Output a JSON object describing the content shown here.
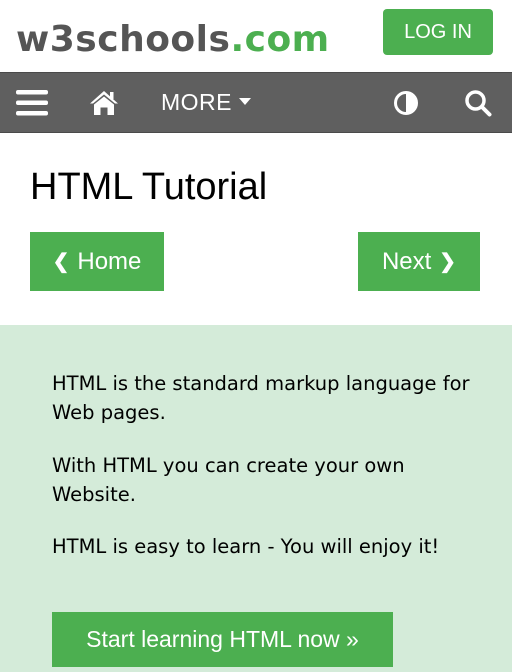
{
  "header": {
    "logo_main": "w3schools",
    "logo_suffix": ".com",
    "login_label": "LOG IN"
  },
  "nav": {
    "menu_icon": "hamburger-menu-icon",
    "home_icon": "home-icon",
    "more_label": "MORE",
    "theme_icon": "contrast-icon",
    "search_icon": "search-icon"
  },
  "main": {
    "title": "HTML Tutorial",
    "prev_label": "Home",
    "prev_chevron": "❮",
    "next_label": "Next",
    "next_chevron": "❯"
  },
  "intro": {
    "paragraphs": [
      "HTML is the standard markup language for Web pages.",
      "With HTML you can create your own Website.",
      "HTML is easy to learn - You will enjoy it!"
    ],
    "cta_label": "Start learning HTML now »"
  },
  "colors": {
    "brand_green": "#4caf50",
    "nav_gray": "#5f5f5f",
    "intro_bg": "#d4ebd9",
    "logo_gray": "#555555"
  }
}
